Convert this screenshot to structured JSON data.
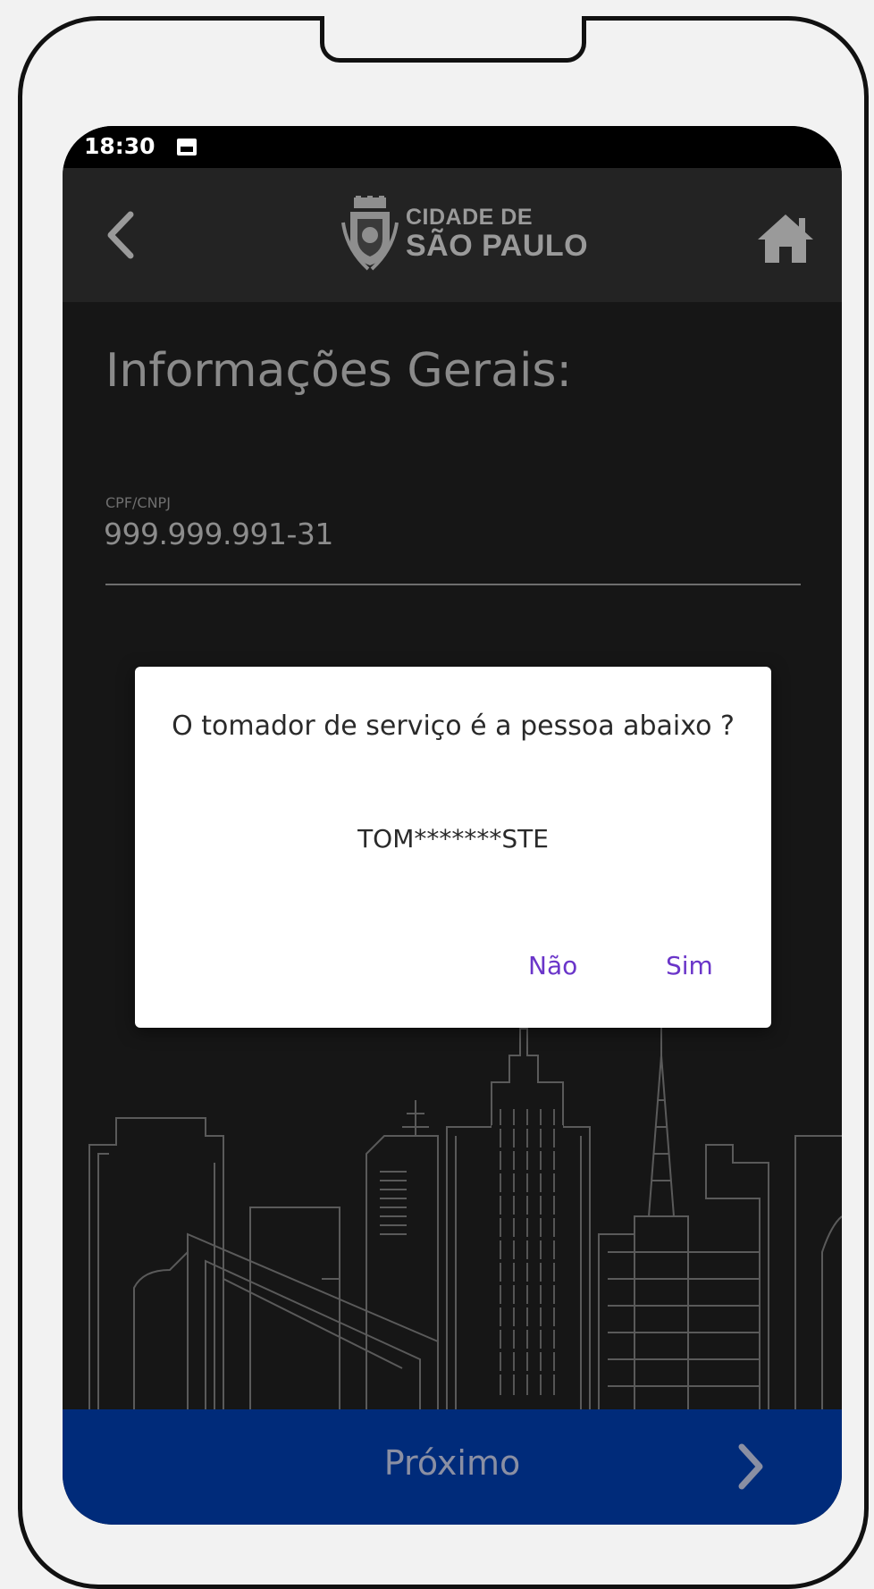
{
  "status_bar": {
    "time": "18:30"
  },
  "app_bar": {
    "brand_line1": "CIDADE DE",
    "brand_line2": "SÃO PAULO"
  },
  "page": {
    "title": "Informações Gerais:",
    "field_label": "CPF/CNPJ",
    "field_value": "999.999.991-31"
  },
  "dialog": {
    "message": "O tomador de serviço é a pessoa abaixo ?",
    "name": "TOM*******STE",
    "no_label": "Não",
    "yes_label": "Sim"
  },
  "footer": {
    "next_label": "Próximo"
  },
  "colors": {
    "footer_bg": "#002b7a",
    "dialog_button": "#6a35c9",
    "screen_bg": "#161616",
    "app_bar_bg": "#232323"
  }
}
